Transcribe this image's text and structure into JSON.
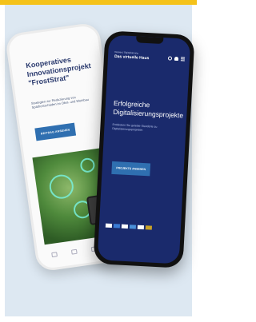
{
  "colors": {
    "top_strip": "#f4c21a",
    "card_bg": "#dde8f2",
    "accent_blue": "#2f6fb0",
    "navy": "#1a2a6c"
  },
  "white_phone": {
    "title": "Kooperatives Innovationsprojekt \"FrostStrat\"",
    "description": "Strategien zur Reduzierung von Spätfrostschäden im Obst- und Weinbau",
    "button_label": "BEITRAG ANSEHEN",
    "bottom_nav_icons": [
      "home-icon",
      "doc-icon",
      "mail-icon",
      "menu-icon"
    ]
  },
  "black_phone": {
    "logo_small": "Hessen | Digitalisierung",
    "logo": "Das virtuelle Haus",
    "header_icons": [
      "search-icon",
      "user-icon",
      "menu-icon"
    ],
    "title": "Erfolgreiche Digitalisierungsprojekte",
    "description": "Entdecken Sie gelebte Standorte zu Digitalisierungsprojekten",
    "button_label": "PROJEKTE ANSEHEN",
    "partner_logos": [
      "logo-1",
      "logo-2",
      "logo-3",
      "logo-4",
      "logo-5",
      "logo-6"
    ]
  }
}
